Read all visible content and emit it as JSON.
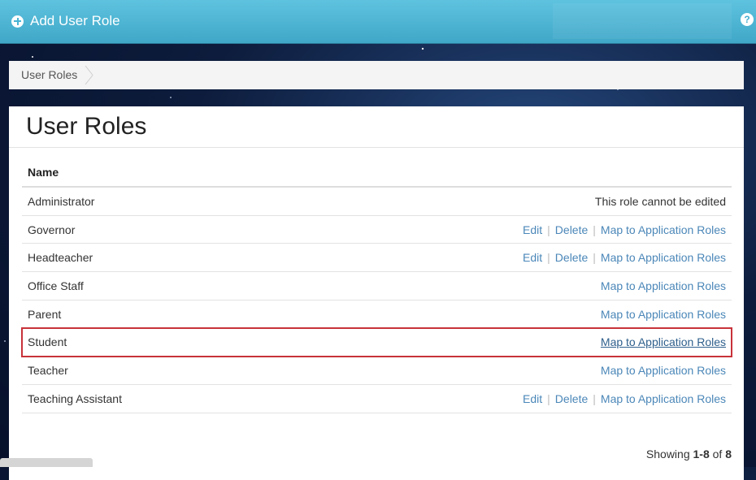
{
  "header": {
    "add_role_label": "Add User Role",
    "help_glyph": "?"
  },
  "breadcrumb": {
    "items": [
      "User Roles"
    ]
  },
  "page": {
    "title": "User Roles"
  },
  "table": {
    "column_name": "Name",
    "rows": [
      {
        "name": "Administrator",
        "note": "This role cannot be edited"
      },
      {
        "name": "Governor",
        "edit": "Edit",
        "delete": "Delete",
        "map": "Map to Application Roles"
      },
      {
        "name": "Headteacher",
        "edit": "Edit",
        "delete": "Delete",
        "map": "Map to Application Roles"
      },
      {
        "name": "Office Staff",
        "map": "Map to Application Roles"
      },
      {
        "name": "Parent",
        "map": "Map to Application Roles"
      },
      {
        "name": "Student",
        "map": "Map to Application Roles"
      },
      {
        "name": "Teacher",
        "map": "Map to Application Roles"
      },
      {
        "name": "Teaching Assistant",
        "edit": "Edit",
        "delete": "Delete",
        "map": "Map to Application Roles"
      }
    ],
    "separator": "|"
  },
  "paging": {
    "prefix": "Showing",
    "range": "1-8",
    "of": "of",
    "total": "8"
  },
  "colors": {
    "header": "#4ab3d3",
    "link": "#4b87b8",
    "highlight": "#c8323a"
  },
  "icons": {
    "add": "plus-circle-icon",
    "help": "help-icon"
  }
}
